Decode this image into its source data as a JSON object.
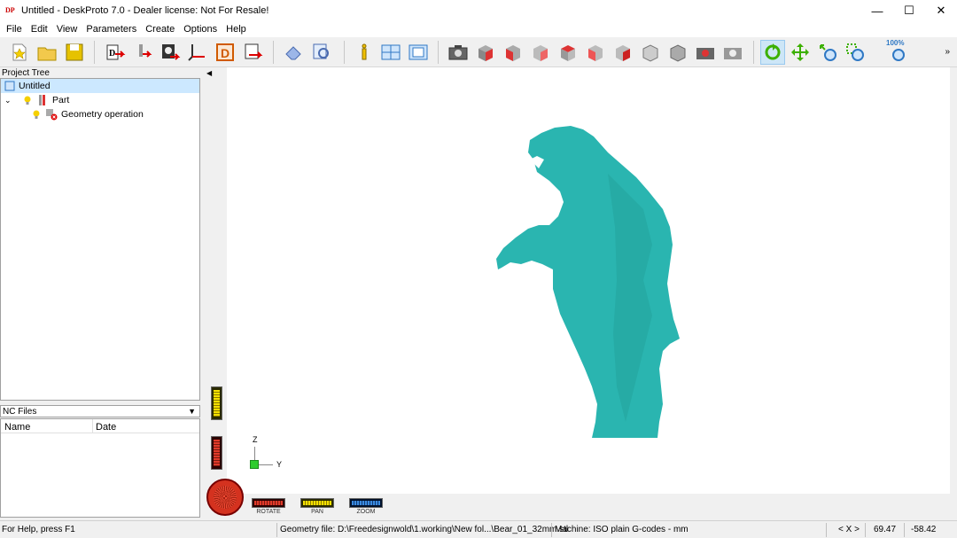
{
  "window": {
    "title": "Untitled - DeskProto 7.0 - Dealer license: Not For Resale!",
    "app_icon": "DP"
  },
  "menu": [
    "File",
    "Edit",
    "View",
    "Parameters",
    "Create",
    "Options",
    "Help"
  ],
  "project_tree": {
    "header": "Project Tree",
    "root": "Untitled",
    "part": "Part",
    "operation": "Geometry operation"
  },
  "nc_files": {
    "header": "NC Files",
    "col_name": "Name",
    "col_date": "Date"
  },
  "viewport": {
    "axis_z": "Z",
    "axis_y": "Y"
  },
  "controls": {
    "rotate": "ROTATE",
    "pan": "PAN",
    "zoom": "ZOOM"
  },
  "toolbar": {
    "zoom_percent": "100%"
  },
  "status": {
    "help": "For Help, press F1",
    "geometry_file": "Geometry file: D:\\Freedesignwold\\1.working\\New fol...\\Bear_01_32mm.stl",
    "machine": "Machine: ISO plain G-codes - mm",
    "axis_toggle": "< X >",
    "coord_x": "69.47",
    "coord_y": "-58.42"
  },
  "colors": {
    "model": "#2ab5b0",
    "accent": "#cde6f7"
  }
}
